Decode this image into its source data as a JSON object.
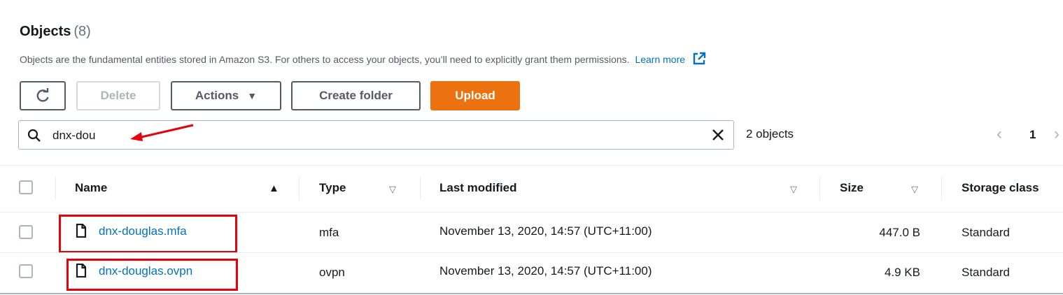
{
  "header": {
    "title": "Objects",
    "count": "(8)",
    "description": "Objects are the fundamental entities stored in Amazon S3. For others to access your objects, you’ll need to explicitly grant them permissions.",
    "learn_more": "Learn more"
  },
  "toolbar": {
    "delete_label": "Delete",
    "actions_label": "Actions",
    "create_folder_label": "Create folder",
    "upload_label": "Upload"
  },
  "search": {
    "value": "dnx-dou",
    "result_count": "2 objects"
  },
  "pagination": {
    "prev": "‹",
    "current": "1",
    "next": "›"
  },
  "columns": {
    "name": "Name",
    "type": "Type",
    "last_modified": "Last modified",
    "size": "Size",
    "storage_class": "Storage class"
  },
  "rows": [
    {
      "name": "dnx-douglas.mfa",
      "type": "mfa",
      "last_modified": "November 13, 2020, 14:57 (UTC+11:00)",
      "size": "447.0 B",
      "storage_class": "Standard"
    },
    {
      "name": "dnx-douglas.ovpn",
      "type": "ovpn",
      "last_modified": "November 13, 2020, 14:57 (UTC+11:00)",
      "size": "4.9 KB",
      "storage_class": "Standard"
    }
  ],
  "colors": {
    "primary": "#ec7211",
    "link": "#0073bb",
    "annotation": "#e8000b"
  }
}
